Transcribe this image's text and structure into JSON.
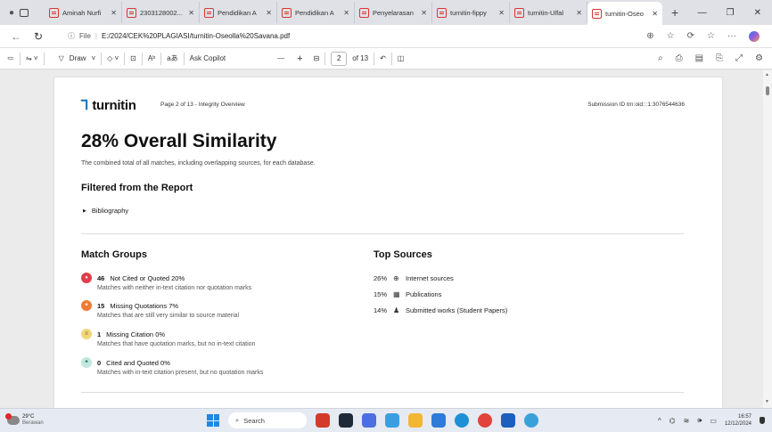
{
  "browser": {
    "tabs": [
      {
        "title": "Aminah Nurfi"
      },
      {
        "title": "2303128002..."
      },
      {
        "title": "Pendidikan A"
      },
      {
        "title": "Pendidikan A"
      },
      {
        "title": "Penyelarasan"
      },
      {
        "title": "turnitin-fippy"
      },
      {
        "title": "turnitin-Ulfal"
      },
      {
        "title": "turnitin-Oseo",
        "active": true
      }
    ],
    "url_scheme": "File",
    "url": "E:/2024/CEK%20PLAGIASI/turnitin-Oseolla%20Savana.pdf"
  },
  "pdf_toolbar": {
    "draw_label": "Draw",
    "ask_copilot_label": "Ask Copilot",
    "minus": "—",
    "plus": "+",
    "page_current": "2",
    "page_total": "of 13"
  },
  "report": {
    "brand": "turnitin",
    "page_label": "Page 2 of 13 - Integrity Overview",
    "submission_id": "Submission ID trn:oid:::1:3076544636",
    "overall_title": "28% Overall Similarity",
    "overall_desc": "The combined total of all matches, including overlapping sources, for each database.",
    "filtered_title": "Filtered from the Report",
    "filtered_items": [
      "Bibliography"
    ],
    "match_groups_title": "Match Groups",
    "match_groups": [
      {
        "count": "46",
        "label": "Not Cited or Quoted 20%",
        "desc": "Matches with neither in-text citation nor quotation marks",
        "color": "#e03d4a",
        "icon": "●"
      },
      {
        "count": "15",
        "label": "Missing Quotations 7%",
        "desc": "Matches that are still very similar to source material",
        "color": "#f07a35",
        "icon": "❝"
      },
      {
        "count": "1",
        "label": "Missing Citation 0%",
        "desc": "Matches that have quotation marks, but no in-text citation",
        "color": "#f2d679",
        "icon": "≡"
      },
      {
        "count": "0",
        "label": "Cited and Quoted 0%",
        "desc": "Matches with in-text citation present, but no quotation marks",
        "color": "#bfe7dd",
        "icon": "❝"
      }
    ],
    "top_sources_title": "Top Sources",
    "top_sources": [
      {
        "pct": "26%",
        "label": "Internet sources",
        "icon": "globe-icon"
      },
      {
        "pct": "15%",
        "label": "Publications",
        "icon": "book-icon"
      },
      {
        "pct": "14%",
        "label": "Submitted works (Student Papers)",
        "icon": "person-icon"
      }
    ]
  },
  "taskbar": {
    "temp": "29°C",
    "weather": "Berawan",
    "search_placeholder": "Search",
    "time": "16:57",
    "date": "12/12/2024"
  }
}
